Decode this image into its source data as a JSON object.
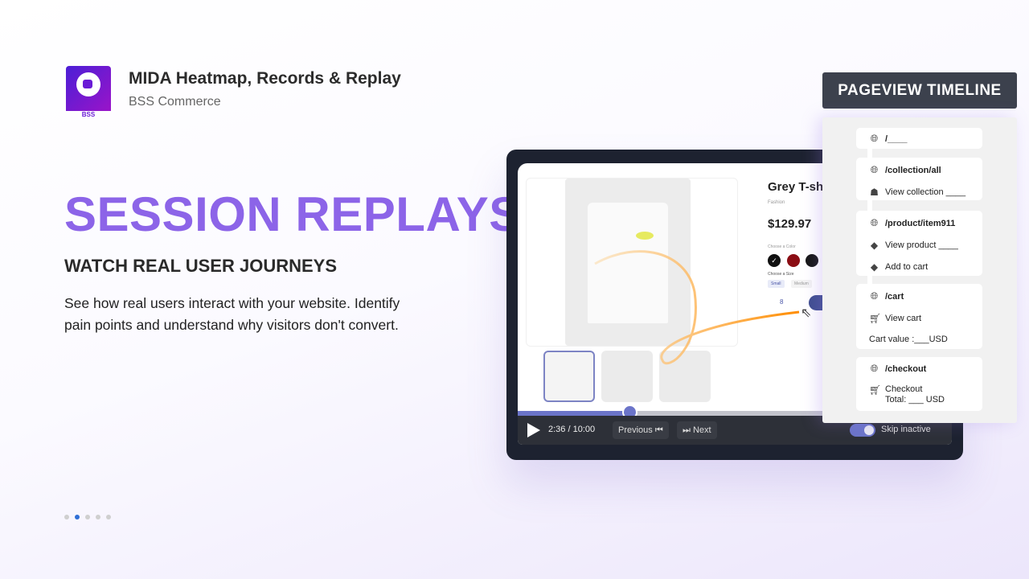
{
  "app": {
    "title": "MIDA Heatmap, Records & Replay",
    "vendor": "BSS Commerce",
    "logo_text": "BSS"
  },
  "hero": {
    "headline": "SESSION REPLAYS",
    "subheadline": "WATCH REAL USER JOURNEYS",
    "description": "See how real users interact with your website. Identify pain points and understand why visitors don't convert."
  },
  "carousel": {
    "count": 5,
    "active": 2
  },
  "player": {
    "product": {
      "title": "Grey T-shirt",
      "category": "Fashion",
      "price": "$129.97",
      "color_label": "Choose a Color",
      "size_label": "Choose a Size",
      "sizes": [
        "Small",
        "Medium"
      ],
      "quantity": "8",
      "colors": [
        "#111111",
        "#8b0d14",
        "#151515"
      ]
    },
    "time": "2:36 / 10:00",
    "progress": 0.26,
    "previous_label": "Previous",
    "next_label": "Next",
    "skip_inactive_label": "Skip inactive",
    "skip_inactive": true
  },
  "timeline": {
    "title": "PAGEVIEW TIMELINE",
    "entries": [
      {
        "path": "/____",
        "events": []
      },
      {
        "path": "/collection/all",
        "events": [
          {
            "icon": "collection-icon",
            "label": "View collection ____"
          }
        ]
      },
      {
        "path": "/product/item911",
        "events": [
          {
            "icon": "tag-icon",
            "label": "View product ____"
          },
          {
            "icon": "add-to-cart-tag-icon",
            "label": "Add to cart"
          }
        ]
      },
      {
        "path": "/cart",
        "events": [
          {
            "icon": "cart-outline-icon",
            "label": "View cart"
          },
          {
            "icon": "",
            "label": "Cart value :___USD"
          }
        ]
      },
      {
        "path": "/checkout",
        "events": [
          {
            "icon": "cart-filled-icon",
            "label": "Checkout\nTotal: ___ USD"
          }
        ]
      }
    ]
  }
}
